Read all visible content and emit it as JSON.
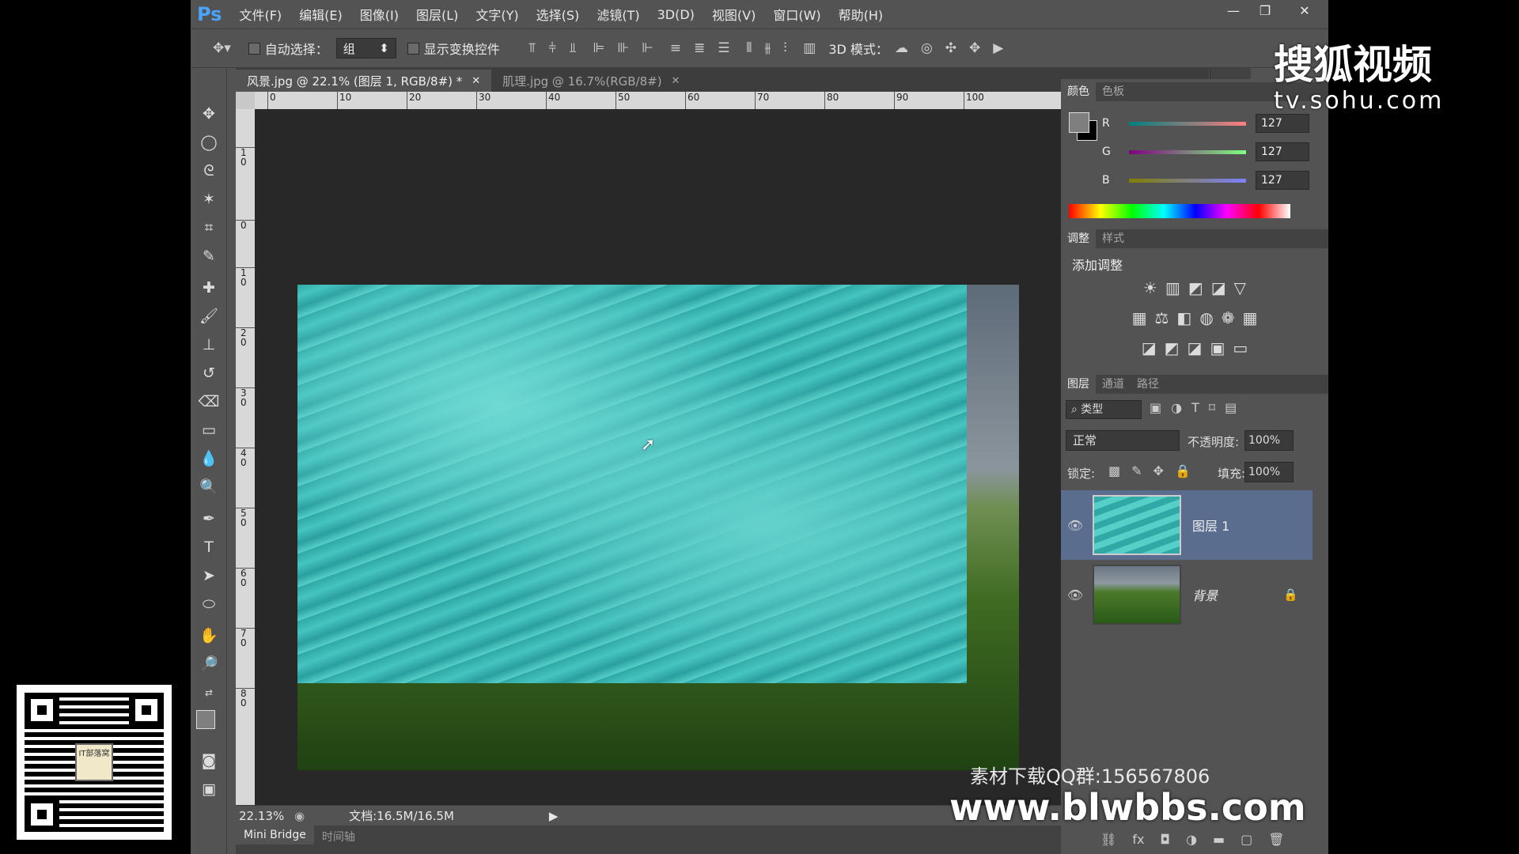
{
  "app": {
    "logo": "Ps",
    "menu": [
      "文件(F)",
      "编辑(E)",
      "图像(I)",
      "图层(L)",
      "文字(Y)",
      "选择(S)",
      "滤镜(T)",
      "3D(D)",
      "视图(V)",
      "窗口(W)",
      "帮助(H)"
    ],
    "window_controls": {
      "minimize": "—",
      "restore": "❐",
      "close": "✕"
    }
  },
  "options_bar": {
    "auto_select_label": "自动选择：",
    "auto_select_value": "组",
    "show_transform_label": "显示变换控件",
    "mode_3d_label": "3D 模式："
  },
  "document": {
    "tabs": [
      {
        "label": "风景.jpg @ 22.1% (图层 1, RGB/8#) *",
        "close": "✕",
        "active": true
      },
      {
        "label": "肌理.jpg @ 16.7%(RGB/8#)",
        "close": "✕",
        "active": false
      }
    ],
    "ruler_h": [
      "0",
      "10",
      "20",
      "30",
      "40",
      "50",
      "60",
      "70",
      "80",
      "90",
      "100"
    ],
    "ruler_v": [
      "1\n0",
      "0",
      "1\n0",
      "2\n0",
      "3\n0",
      "4\n0",
      "5\n0",
      "6\n0",
      "7\n0",
      "8\n0"
    ],
    "zoom": "22.13%",
    "doc_info": "文档:16.5M/16.5M",
    "bottom_tabs": [
      "Mini Bridge",
      "时间轴"
    ]
  },
  "color_panel": {
    "tabs": [
      "颜色",
      "色板"
    ],
    "r_label": "R",
    "r_value": "127",
    "g_label": "G",
    "g_value": "127",
    "b_label": "B",
    "b_value": "127",
    "foreground": "#7f7f7f",
    "background": "#000000"
  },
  "adjust_panel": {
    "tabs": [
      "调整",
      "样式"
    ],
    "title": "添加调整"
  },
  "layers_panel": {
    "tabs": [
      "图层",
      "通道",
      "路径"
    ],
    "filter_label": "类型",
    "blend_mode": "正常",
    "opacity_label": "不透明度:",
    "opacity_value": "100%",
    "lock_label": "锁定:",
    "fill_label": "填充:",
    "fill_value": "100%",
    "layers": [
      {
        "name": "图层 1",
        "selected": true
      },
      {
        "name": "背景",
        "locked": true
      }
    ]
  },
  "watermarks": {
    "sohu": "搜狐视频",
    "sohu_url": "tv.sohu.com",
    "qq": "素材下载QQ群:156567806",
    "site": "www.blwbbs.com"
  },
  "qr_label": "IT部落窝"
}
